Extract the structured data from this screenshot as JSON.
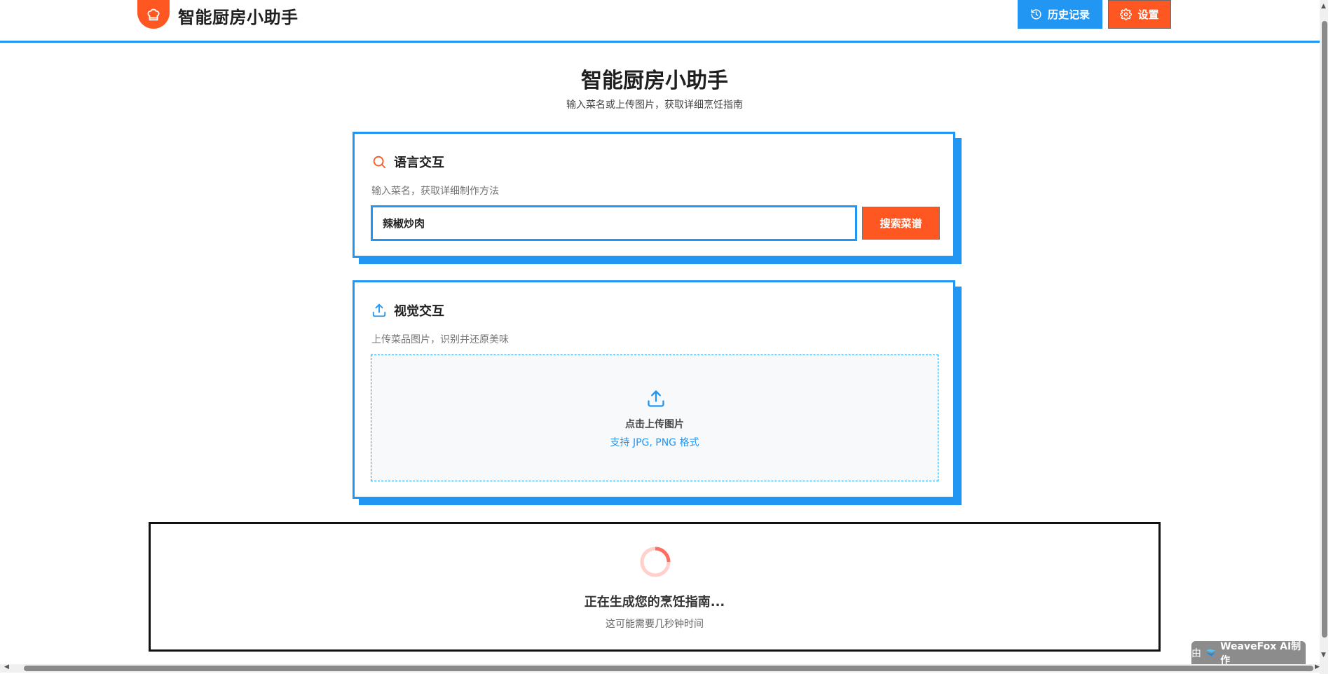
{
  "header": {
    "app_title": "智能厨房小助手",
    "history_label": "历史记录",
    "settings_label": "设置",
    "icons": [
      "chef-hat-icon",
      "history-icon",
      "gear-icon"
    ],
    "brand_color": "#ff5722",
    "accent_color": "#2196f3"
  },
  "hero": {
    "title": "智能厨房小助手",
    "subtitle": "输入菜名或上传图片，获取详细烹饪指南"
  },
  "language_card": {
    "icon": "search-icon",
    "title": "语言交互",
    "description": "输入菜名，获取详细制作方法",
    "input_value": "辣椒炒肉",
    "search_button": "搜索菜谱"
  },
  "visual_card": {
    "icon": "upload-icon",
    "title": "视觉交互",
    "description": "上传菜品图片，识别并还原美味",
    "upload_label": "点击上传图片",
    "upload_hint": "支持 JPG, PNG 格式"
  },
  "loading": {
    "title": "正在生成您的烹饪指南...",
    "subtitle": "这可能需要几秒钟时间"
  },
  "badge": {
    "prefix": "由",
    "text": "WeaveFox AI制作",
    "icon": "weavefox-logo-icon"
  }
}
